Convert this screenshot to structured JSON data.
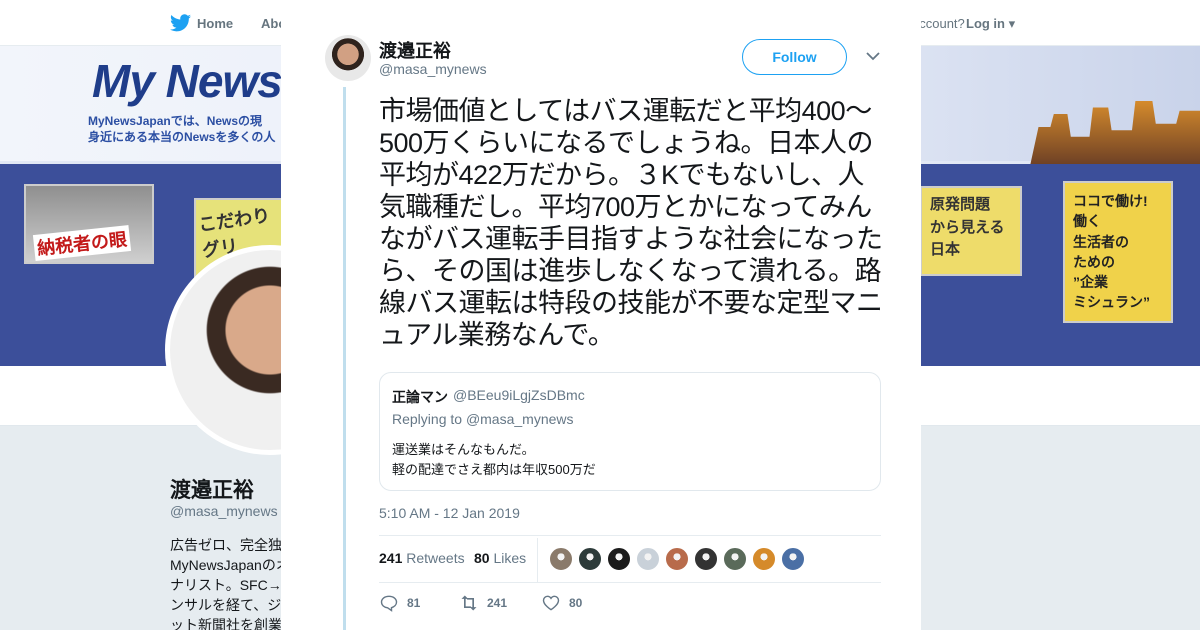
{
  "nav": {
    "home": "Home",
    "about": "Abo",
    "account": "account?",
    "login": "Log in"
  },
  "banner": {
    "logo": "My News",
    "tagline_1": "MyNewsJapanでは、Newsの現",
    "tagline_2": "身近にある本当のNewsを多くの人",
    "panel_1": "納税者の眼",
    "panel_2": "こだわり\nグリ",
    "panel_3": "原発問題\nから見える\n日本",
    "panel_4": "ココで働け!\n働く\n生活者の\nための\n”企業\nミシュラン”"
  },
  "profile": {
    "name": "渡邉正裕",
    "handle": "@masa_mynews",
    "bio": "広告ゼロ、完全独\nMyNewsJapanのオ\nナリスト。SFC→\nンサルを経て、ジ\nット新聞社を創業"
  },
  "tweet": {
    "author_name": "渡邉正裕",
    "author_handle": "@masa_mynews",
    "follow_label": "Follow",
    "text": "市場価値としてはバス運転だと平均400～500万くらいになるでしょうね。日本人の平均が422万だから。３Kでもないし、人気職種だし。平均700万とかになってみんながバス運転手目指すような社会になったら、その国は進歩しなくなって潰れる。路線バス運転は特段の技能が不要な定型マニュアル業務なんで。",
    "timestamp": "5:10 AM - 12 Jan 2019",
    "retweets": "241",
    "retweets_label": "Retweets",
    "likes": "80",
    "likes_label": "Likes",
    "reply_count": "81",
    "retweet_count": "241",
    "like_count": "80"
  },
  "quote": {
    "name": "正論マン",
    "handle": "@BEeu9iLgjZsDBmc",
    "replying_to_prefix": "Replying to",
    "replying_to_handle": "@masa_mynews",
    "line_1": "運送業はそんなもんだ。",
    "line_2": "軽の配達でさえ都内は年収500万だ"
  },
  "likers": [
    {
      "color": "#8a7a6a"
    },
    {
      "color": "#2d3b3a"
    },
    {
      "color": "#1b1b1b"
    },
    {
      "color": "#c9d1d9"
    },
    {
      "color": "#b86b4b"
    },
    {
      "color": "#333333"
    },
    {
      "color": "#5a6a5a"
    },
    {
      "color": "#d58a2a"
    },
    {
      "color": "#4a6fa5"
    }
  ],
  "colors": {
    "accent": "#1da1f2",
    "thread_line": "#c0deed",
    "muted": "#657786"
  }
}
